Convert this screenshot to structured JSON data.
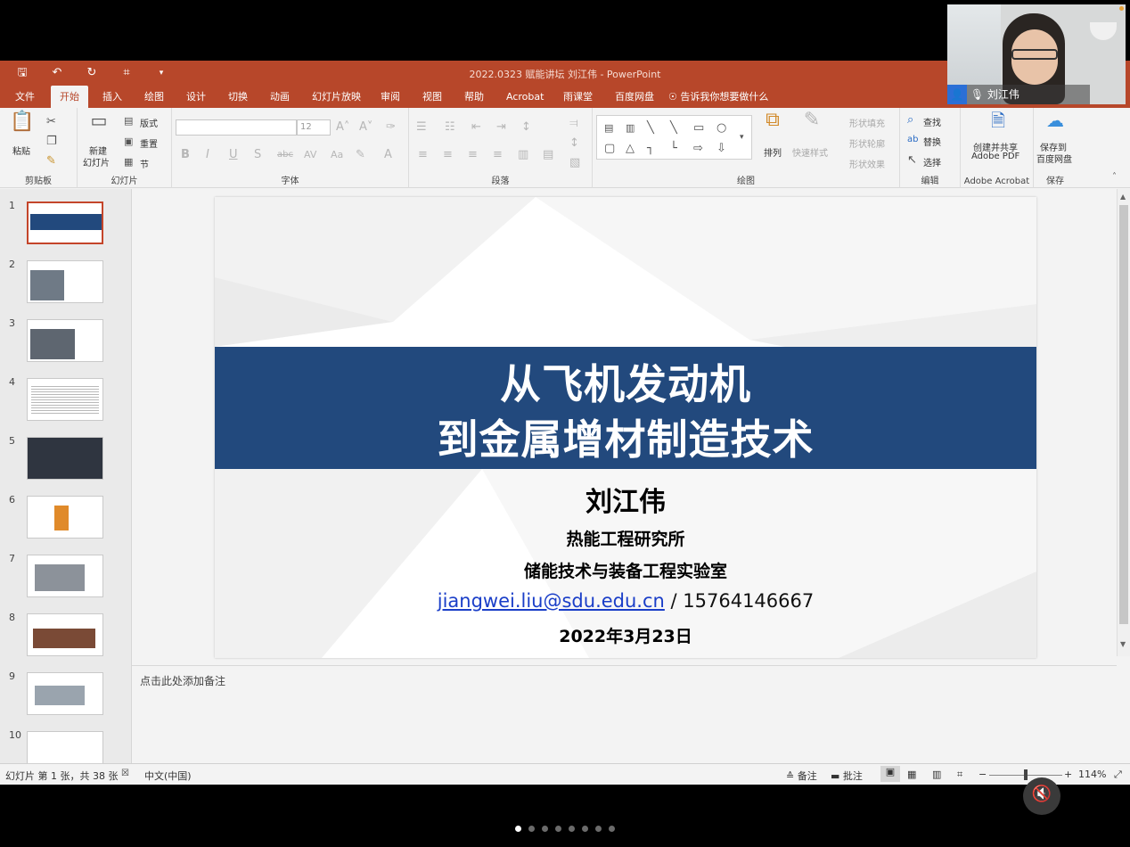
{
  "window": {
    "title": "2022.0323 赋能讲坛 刘江伟 - PowerPoint"
  },
  "tabs": [
    "文件",
    "开始",
    "插入",
    "绘图",
    "设计",
    "切换",
    "动画",
    "幻灯片放映",
    "审阅",
    "视图",
    "帮助",
    "Acrobat",
    "雨课堂",
    "百度网盘"
  ],
  "active_tab": "开始",
  "tell_me": "告诉我你想要做什么",
  "ribbon": {
    "clipboard": {
      "label": "剪贴板",
      "paste": "粘贴"
    },
    "slides": {
      "label": "幻灯片",
      "new_slide": "新建",
      "new_slide2": "幻灯片",
      "layout": "版式",
      "reset": "重置",
      "section": "节"
    },
    "font": {
      "label": "字体",
      "size": "12"
    },
    "paragraph": {
      "label": "段落"
    },
    "drawing": {
      "label": "绘图",
      "arrange": "排列",
      "quick_styles": "快速样式",
      "shape_fill": "形状填充",
      "shape_outline": "形状轮廓",
      "shape_effects": "形状效果"
    },
    "editing": {
      "label": "编辑",
      "find": "查找",
      "replace": "替换",
      "select": "选择"
    },
    "acrobat": {
      "label": "Adobe Acrobat",
      "create_share": "创建并共享",
      "adobe_pdf": "Adobe PDF"
    },
    "save": {
      "label": "保存",
      "save_to": "保存到",
      "baidu": "百度网盘"
    }
  },
  "thumbnails": [
    "1",
    "2",
    "3",
    "4",
    "5",
    "6",
    "7",
    "8",
    "9",
    "10"
  ],
  "slide": {
    "title_line1": "从飞机发动机",
    "title_line2": "到金属增材制造技术",
    "author": "刘江伟",
    "institute": "热能工程研究所",
    "lab": "储能技术与装备工程实验室",
    "email": "jiangwei.liu@sdu.edu.cn",
    "phone": " / 15764146667",
    "date": "2022年3月23日"
  },
  "notes_placeholder": "点击此处添加备注",
  "status": {
    "slide_info": "幻灯片 第 1 张，共 38 张",
    "language": "中文(中国)",
    "notes": "备注",
    "comments": "批注",
    "zoom": "114%"
  },
  "video": {
    "participant": "刘江伟"
  },
  "carousel": {
    "count": 8,
    "active": 0
  },
  "colors": {
    "accent": "#b7472a",
    "band": "#22497d",
    "link": "#1a3ec8"
  }
}
